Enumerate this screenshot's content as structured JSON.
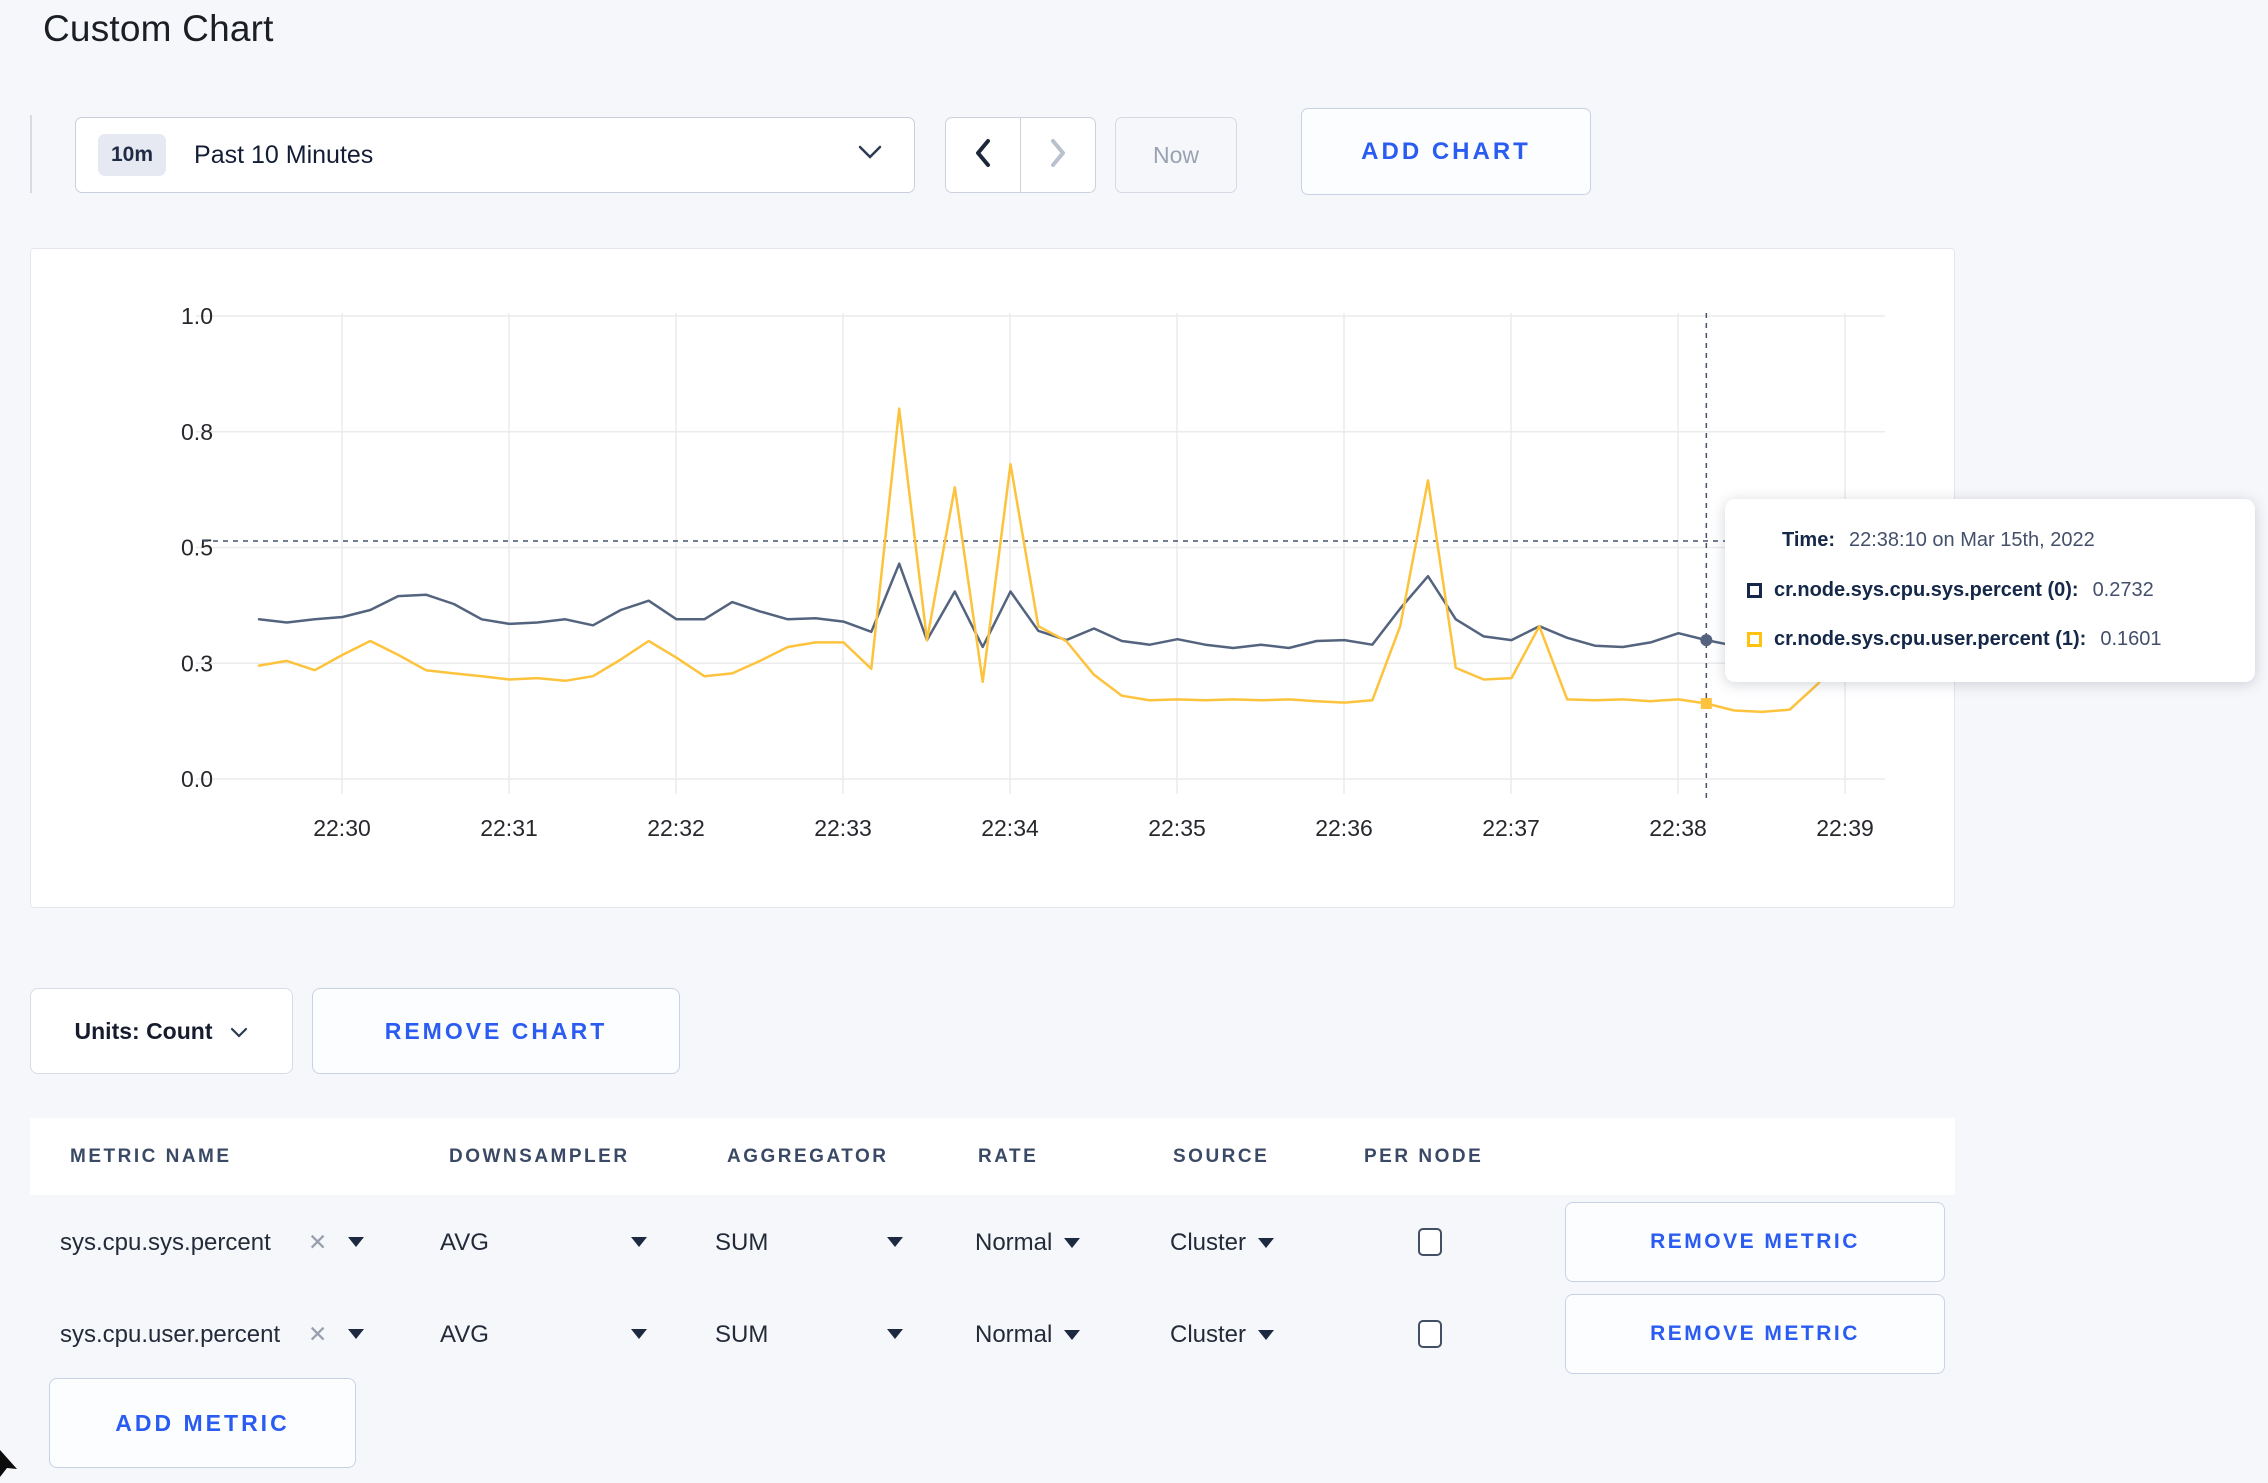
{
  "page": {
    "title": "Custom Chart",
    "accent_blue": "#2b5cf2"
  },
  "toolbar": {
    "time_range": {
      "badge": "10m",
      "label": "Past 10 Minutes"
    },
    "now_label": "Now",
    "add_chart_label": "ADD CHART"
  },
  "tooltip": {
    "time_label": "Time:",
    "time_value": "22:38:10 on Mar 15th, 2022",
    "rows": [
      {
        "label": "cr.node.sys.cpu.sys.percent (0):",
        "value": "0.2732",
        "color": "#152849"
      },
      {
        "label": "cr.node.sys.cpu.user.percent (1):",
        "value": "0.1601",
        "color": "#ffc20e"
      }
    ]
  },
  "controls": {
    "units_label": "Units: Count",
    "remove_chart_label": "REMOVE CHART",
    "add_metric_label": "ADD METRIC",
    "remove_metric_label": "REMOVE METRIC"
  },
  "metrics_table": {
    "headers": [
      "METRIC NAME",
      "DOWNSAMPLER",
      "AGGREGATOR",
      "RATE",
      "SOURCE",
      "PER NODE"
    ],
    "rows": [
      {
        "metric": "sys.cpu.sys.percent",
        "downsampler": "AVG",
        "aggregator": "SUM",
        "rate": "Normal",
        "source": "Cluster",
        "per_node_checked": false
      },
      {
        "metric": "sys.cpu.user.percent",
        "downsampler": "AVG",
        "aggregator": "SUM",
        "rate": "Normal",
        "source": "Cluster",
        "per_node_checked": false
      }
    ]
  },
  "chart_data": {
    "type": "line",
    "title": "",
    "x_start_time": "22:29:30",
    "x_interval_seconds": 10,
    "x_tick_labels": [
      "22:30",
      "22:31",
      "22:32",
      "22:33",
      "22:34",
      "22:35",
      "22:36",
      "22:37",
      "22:38",
      "22:39"
    ],
    "y_axis": {
      "range": [
        0,
        1.0
      ],
      "ticks": [
        {
          "value": 0,
          "label": "0.0"
        },
        {
          "value": 0.25,
          "label": "0.3"
        },
        {
          "value": 0.5,
          "label": "0.5"
        },
        {
          "value": 0.75,
          "label": "0.8"
        },
        {
          "value": 1.0,
          "label": "1.0"
        }
      ]
    },
    "grid": true,
    "legend_position": "none",
    "series": [
      {
        "name": "cr.node.sys.cpu.sys.percent (0)",
        "color": "#54647e",
        "values": [
          0.345,
          0.338,
          0.345,
          0.35,
          0.365,
          0.395,
          0.398,
          0.378,
          0.345,
          0.335,
          0.338,
          0.345,
          0.332,
          0.365,
          0.385,
          0.345,
          0.345,
          0.382,
          0.362,
          0.345,
          0.347,
          0.34,
          0.318,
          0.465,
          0.3,
          0.405,
          0.285,
          0.405,
          0.32,
          0.3,
          0.325,
          0.298,
          0.29,
          0.302,
          0.29,
          0.283,
          0.29,
          0.283,
          0.298,
          0.3,
          0.29,
          0.368,
          0.438,
          0.345,
          0.308,
          0.3,
          0.33,
          0.305,
          0.288,
          0.285,
          0.295,
          0.315,
          0.3,
          0.288,
          0.295,
          0.295,
          0.298,
          0.3,
          0.292
        ]
      },
      {
        "name": "cr.node.sys.cpu.user.percent (1)",
        "color": "#fdc33d",
        "values": [
          0.245,
          0.255,
          0.235,
          0.268,
          0.298,
          0.268,
          0.235,
          0.228,
          0.222,
          0.215,
          0.218,
          0.212,
          0.222,
          0.258,
          0.298,
          0.262,
          0.222,
          0.228,
          0.255,
          0.285,
          0.295,
          0.295,
          0.238,
          0.8,
          0.3,
          0.63,
          0.21,
          0.68,
          0.33,
          0.298,
          0.225,
          0.18,
          0.17,
          0.172,
          0.17,
          0.172,
          0.17,
          0.172,
          0.168,
          0.165,
          0.17,
          0.33,
          0.645,
          0.24,
          0.215,
          0.218,
          0.33,
          0.172,
          0.17,
          0.172,
          0.168,
          0.172,
          0.163,
          0.148,
          0.145,
          0.15,
          0.205,
          0.28,
          0.235
        ]
      }
    ],
    "crosshair": {
      "time": "22:38:10",
      "index": 52,
      "y_value": 0.514
    },
    "hover_points": [
      {
        "series": 0,
        "value": 0.3,
        "marker": "circle"
      },
      {
        "series": 1,
        "value": 0.163,
        "marker": "square"
      }
    ]
  }
}
